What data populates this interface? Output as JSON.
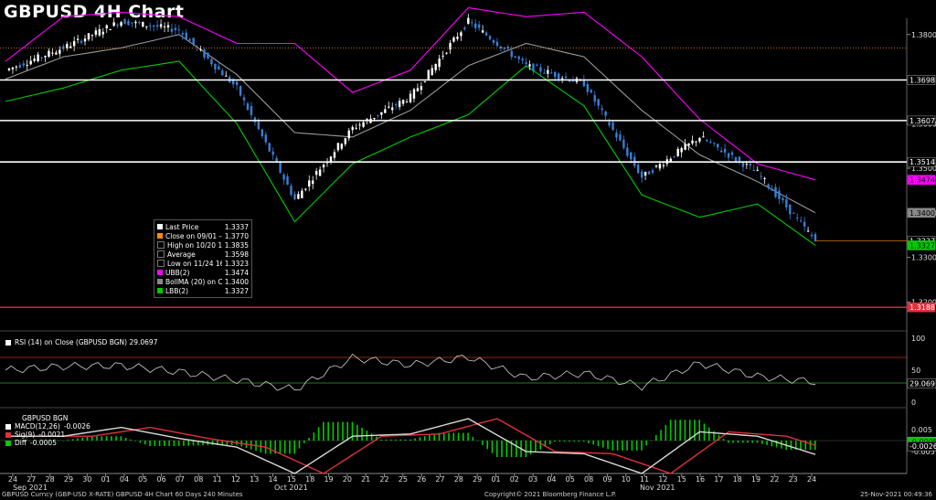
{
  "title": "GBPUSD 4H Chart",
  "colors": {
    "up": "#ffffff",
    "down": "#3a7fd5",
    "ubb": "#ff00ff",
    "lbb": "#00cc00",
    "ma": "#9a9a9a",
    "close_line": "#ff8c00",
    "support": "#e0303a",
    "level": "#ffffff"
  },
  "price_ticks": [
    "1.3800",
    "1.3600",
    "1.3500",
    "1.3400",
    "1.3300",
    "1.3200"
  ],
  "price_badges": [
    {
      "value": "1.3698",
      "bg": "#000000",
      "fg": "#ffffff"
    },
    {
      "value": "1.3607",
      "bg": "#000000",
      "fg": "#ffffff"
    },
    {
      "value": "1.3514",
      "bg": "#000000",
      "fg": "#ffffff"
    },
    {
      "value": "1.3474",
      "bg": "#ff00ff",
      "fg": "#000000"
    },
    {
      "value": "1.3400",
      "bg": "#888888",
      "fg": "#000000"
    },
    {
      "value": "1.3337",
      "bg": "#000000",
      "fg": "#ffffff"
    },
    {
      "value": "1.3327",
      "bg": "#00cc00",
      "fg": "#000000"
    },
    {
      "value": "1.3188",
      "bg": "#e0303a",
      "fg": "#ffffff"
    }
  ],
  "horizontal_levels": [
    1.3698,
    1.3607,
    1.3514
  ],
  "support_level": 1.3188,
  "close_level": 1.377,
  "legend": [
    {
      "name": "Last Price",
      "value": "1.3337",
      "color": "#ffffff"
    },
    {
      "name": "Close on 09/01 ----",
      "value": "1.3770",
      "color": "#ff8c00"
    },
    {
      "name": "High on 10/20 19:00",
      "value": "1.3835",
      "color": "#000000"
    },
    {
      "name": "Average",
      "value": "1.3598",
      "color": "#000000"
    },
    {
      "name": "Low on 11/24 16:00",
      "value": "1.3323",
      "color": "#000000"
    },
    {
      "name": "UBB(2)",
      "value": "1.3474",
      "color": "#ff00ff"
    },
    {
      "name": "BollMA (20)  on Close",
      "value": "1.3400",
      "color": "#888888"
    },
    {
      "name": "LBB(2)",
      "value": "1.3327",
      "color": "#00cc00"
    }
  ],
  "rsi": {
    "header": "RSI (14)  on Close (GBPUSD BGN) 29.0697",
    "ticks": [
      "100",
      "50",
      "0"
    ],
    "value_badge": "29.0697"
  },
  "macd": {
    "header_title": "GBPUSD BGN",
    "items": [
      {
        "name": "MACD(12,26)",
        "value": "-0.0026",
        "color": "#ffffff"
      },
      {
        "name": "Sig(9)",
        "value": "-0.0021",
        "color": "#e0303a"
      },
      {
        "name": "Diff",
        "value": "-0.0005",
        "color": "#00cc00"
      }
    ],
    "ticks": [
      "0.005",
      "-0.005"
    ],
    "badges": [
      {
        "value": "-0.0005",
        "bg": "#00cc00",
        "fg": "#000000"
      },
      {
        "value": "-0.0026",
        "bg": "#000000",
        "fg": "#ffffff"
      }
    ]
  },
  "x_labels": [
    "24",
    "27",
    "28",
    "29",
    "30",
    "01",
    "04",
    "05",
    "06",
    "07",
    "08",
    "11",
    "12",
    "13",
    "14",
    "15",
    "18",
    "19",
    "20",
    "21",
    "22",
    "25",
    "26",
    "27",
    "28",
    "29",
    "01",
    "02",
    "03",
    "04",
    "05",
    "08",
    "09",
    "10",
    "11",
    "12",
    "15",
    "16",
    "17",
    "18",
    "19",
    "22",
    "23",
    "24"
  ],
  "month_labels": [
    "Sep 2021",
    "Oct 2021",
    "Nov 2021"
  ],
  "footer": {
    "left": "GBPUSD Curncy (GBP-USD X-RATE) GBPUSD 4H Chart 60 Days 240 Minutes",
    "center": "Copyright© 2021 Bloomberg Finance L.P.",
    "right": "25-Nov-2021 00:49:36"
  },
  "chart_data": {
    "type": "line",
    "title": "GBPUSD 4H Chart",
    "xlabel": "",
    "ylabel": "",
    "ylim": [
      1.315,
      1.385
    ],
    "x": [
      "Aug-24",
      "Sep-01",
      "Sep-08",
      "Sep-15",
      "Sep-22",
      "Sep-29",
      "Oct-06",
      "Oct-13",
      "Oct-20",
      "Oct-27",
      "Nov-03",
      "Nov-05",
      "Nov-10",
      "Nov-17",
      "Nov-24"
    ],
    "series": [
      {
        "name": "Last Price",
        "values": [
          1.372,
          1.377,
          1.383,
          1.381,
          1.368,
          1.343,
          1.359,
          1.366,
          1.383,
          1.373,
          1.369,
          1.348,
          1.357,
          1.349,
          1.3337
        ]
      },
      {
        "name": "UBB(2)",
        "values": [
          1.374,
          1.384,
          1.385,
          1.384,
          1.378,
          1.378,
          1.367,
          1.372,
          1.386,
          1.384,
          1.385,
          1.375,
          1.361,
          1.351,
          1.3474
        ]
      },
      {
        "name": "BollMA (20)",
        "values": [
          1.37,
          1.375,
          1.377,
          1.38,
          1.371,
          1.358,
          1.357,
          1.363,
          1.373,
          1.378,
          1.375,
          1.363,
          1.353,
          1.347,
          1.34
        ]
      },
      {
        "name": "LBB(2)",
        "values": [
          1.365,
          1.368,
          1.372,
          1.374,
          1.36,
          1.338,
          1.351,
          1.357,
          1.362,
          1.373,
          1.364,
          1.344,
          1.339,
          1.342,
          1.3327
        ]
      }
    ]
  }
}
